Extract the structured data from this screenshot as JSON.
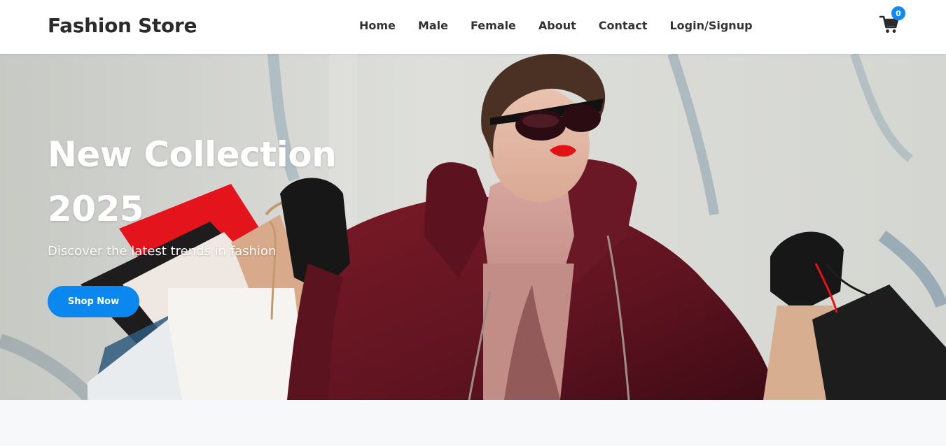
{
  "brand": {
    "name": "Fashion Store"
  },
  "nav": {
    "items": [
      {
        "label": "Home"
      },
      {
        "label": "Male"
      },
      {
        "label": "Female"
      },
      {
        "label": "About"
      },
      {
        "label": "Contact"
      },
      {
        "label": "Login/Signup"
      }
    ]
  },
  "cart": {
    "icon": "shopping-cart-icon",
    "count": "0"
  },
  "hero": {
    "title_line1": "New Collection",
    "title_line2": "2025",
    "subtitle": "Discover the latest trends in fashion",
    "cta_label": "Shop Now"
  },
  "colors": {
    "accent": "#0b87f0",
    "brand_text": "#2b2b2b",
    "coat": "#6e1622"
  }
}
